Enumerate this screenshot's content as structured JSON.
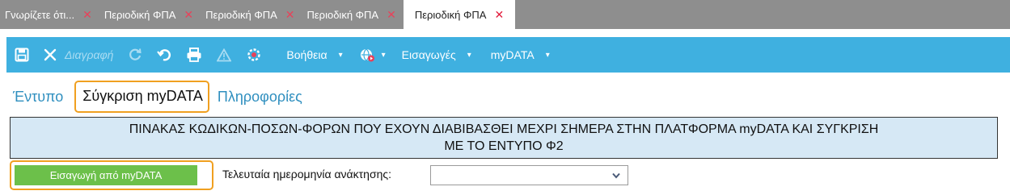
{
  "tabs": [
    {
      "label": "Γνωρίζετε ότι...",
      "active": false
    },
    {
      "label": "Περιοδική ΦΠΑ",
      "active": false
    },
    {
      "label": "Περιοδική ΦΠΑ",
      "active": false
    },
    {
      "label": "Περιοδική ΦΠΑ",
      "active": false
    },
    {
      "label": "Περιοδική ΦΠΑ",
      "active": true
    }
  ],
  "tab_close_glyph": "✕",
  "toolbar": {
    "delete_label": "Διαγραφή",
    "help_label": "Βοήθεια",
    "imports_label": "Εισαγωγές",
    "mydata_label": "myDATA",
    "caret": "▾",
    "icons": [
      "save-icon",
      "close-icon",
      "refresh-icon",
      "undo-icon",
      "print-icon",
      "warning-icon",
      "target-icon",
      "globe-play-icon"
    ]
  },
  "subtabs": [
    {
      "label": "Έντυπο",
      "active": false
    },
    {
      "label": "Σύγκριση myDATA",
      "active": true
    },
    {
      "label": "Πληροφορίες",
      "active": false
    }
  ],
  "header": {
    "line1": "ΠΙΝΑΚΑΣ ΚΩΔΙΚΩΝ-ΠΟΣΩΝ-ΦΟΡΩΝ ΠΟΥ ΕΧΟΥΝ ΔΙΑΒΙΒΑΣΘΕΙ ΜΕΧΡΙ ΣΗΜΕΡΑ ΣΤΗΝ ΠΛΑΤΦΟΡΜΑ myDATA ΚΑΙ ΣΥΓΚΡΙΣΗ",
    "line2": "ΜΕ ΤΟ ΕΝΤΥΠΟ Φ2"
  },
  "import_button_label": "Εισαγωγή από myDATA",
  "date_label": "Τελευταία ημερομηνία ανάκτησης:",
  "date_value": "",
  "colors": {
    "tabstrip": "#8e8e8e",
    "toolbar": "#3fb0e0",
    "accent_outline": "#f0a020",
    "import_button": "#6cc04a",
    "header_bg": "#d6e8f5",
    "tab_close": "#e8425a"
  }
}
